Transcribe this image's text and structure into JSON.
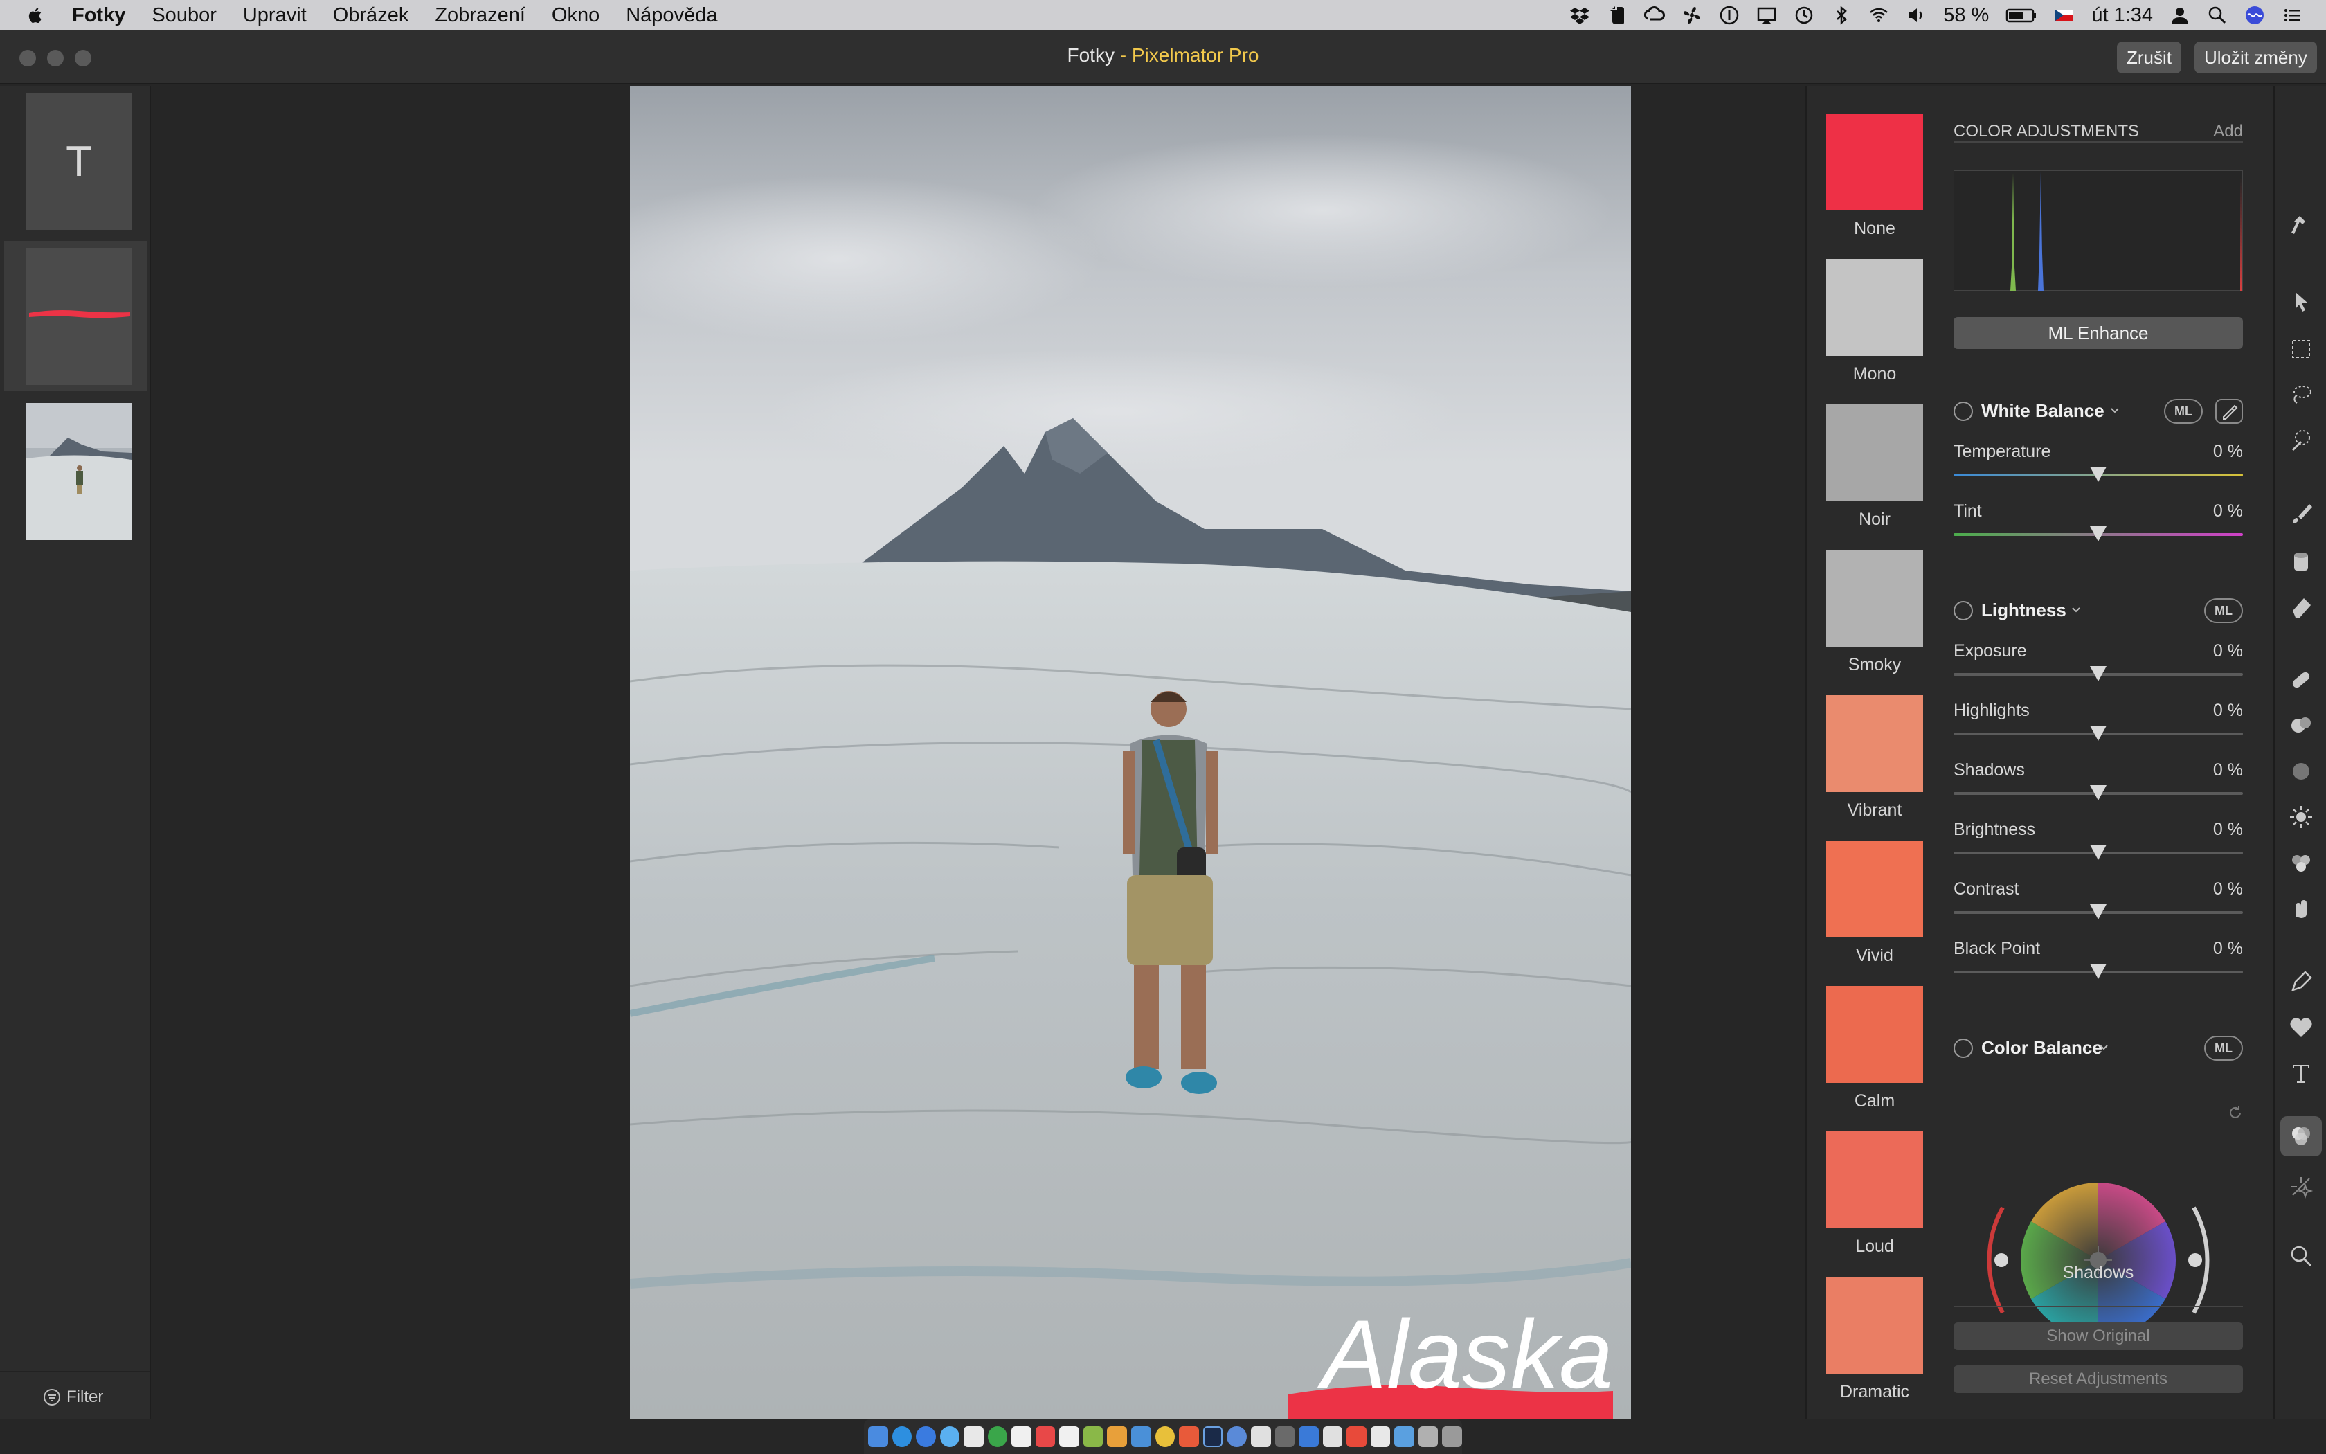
{
  "menubar": {
    "app": "Fotky",
    "items": [
      "Soubor",
      "Upravit",
      "Obrázek",
      "Zobrazení",
      "Okno",
      "Nápověda"
    ],
    "battery": "58 %",
    "clock": "út 1:34",
    "icons": [
      "dropbox-icon",
      "evernote-icon",
      "creative-cloud-icon",
      "fan-icon",
      "info-icon",
      "airplay-icon",
      "time-machine-icon",
      "bluetooth-icon",
      "wifi-icon",
      "volume-icon",
      "battery-icon",
      "flag-icon",
      "user-icon",
      "spotlight-icon",
      "siri-icon",
      "notification-center-icon"
    ]
  },
  "window": {
    "title_main": "Fotky",
    "title_sep": " - ",
    "title_app": "Pixelmator Pro",
    "cancel_label": "Zrušit",
    "save_label": "Uložit změny"
  },
  "layers": {
    "text_layer_glyph": "T",
    "filter_label": "Filter"
  },
  "photo": {
    "overlay_text": "Alaska"
  },
  "presets": [
    {
      "label": "None",
      "color": "#ee3046"
    },
    {
      "label": "Mono",
      "color": "#c4c4c4"
    },
    {
      "label": "Noir",
      "color": "#a7a7a7"
    },
    {
      "label": "Smoky",
      "color": "#b2b2b2"
    },
    {
      "label": "Vibrant",
      "color": "#ea8b6e"
    },
    {
      "label": "Vivid",
      "color": "#ef7052"
    },
    {
      "label": "Calm",
      "color": "#ec6a4f"
    },
    {
      "label": "Loud",
      "color": "#ec6a58"
    },
    {
      "label": "Dramatic",
      "color": "#ea7e64"
    }
  ],
  "adjustments": {
    "header": "COLOR ADJUSTMENTS",
    "add_label": "Add",
    "ml_enhance_label": "ML Enhance",
    "white_balance": {
      "title": "White Balance",
      "ml": "ML",
      "sliders": [
        {
          "label": "Temperature",
          "value": "0 %",
          "level": 0.5
        },
        {
          "label": "Tint",
          "value": "0 %",
          "level": 0.5
        }
      ]
    },
    "lightness": {
      "title": "Lightness",
      "ml": "ML",
      "sliders": [
        {
          "label": "Exposure",
          "value": "0 %",
          "level": 0.5
        },
        {
          "label": "Highlights",
          "value": "0 %",
          "level": 0.5
        },
        {
          "label": "Shadows",
          "value": "0 %",
          "level": 0.5
        },
        {
          "label": "Brightness",
          "value": "0 %",
          "level": 0.5
        },
        {
          "label": "Contrast",
          "value": "0 %",
          "level": 0.5
        },
        {
          "label": "Black Point",
          "value": "0 %",
          "level": 0.5
        }
      ]
    },
    "color_balance": {
      "title": "Color Balance",
      "ml": "ML",
      "wheel_label": "Shadows"
    },
    "show_original_label": "Show Original",
    "reset_label": "Reset Adjustments"
  },
  "tools": [
    "hammer-icon",
    "arrow-select-icon",
    "rect-select-icon",
    "lasso-icon",
    "magic-wand-icon",
    "brush-icon",
    "paint-bucket-icon",
    "eraser-icon",
    "repair-icon",
    "clone-icon",
    "blur-icon",
    "light-icon",
    "retouch-icon",
    "warp-icon",
    "pen-icon",
    "shape-icon",
    "type-icon",
    "color-adjust-icon",
    "effects-icon",
    "zoom-icon"
  ],
  "dock_icons": [
    "finder-icon",
    "safari-icon",
    "chrome-icon",
    "mail-icon",
    "calendar-icon",
    "photos-icon",
    "lightroom-icon",
    "messages-icon",
    "trash-icon"
  ]
}
